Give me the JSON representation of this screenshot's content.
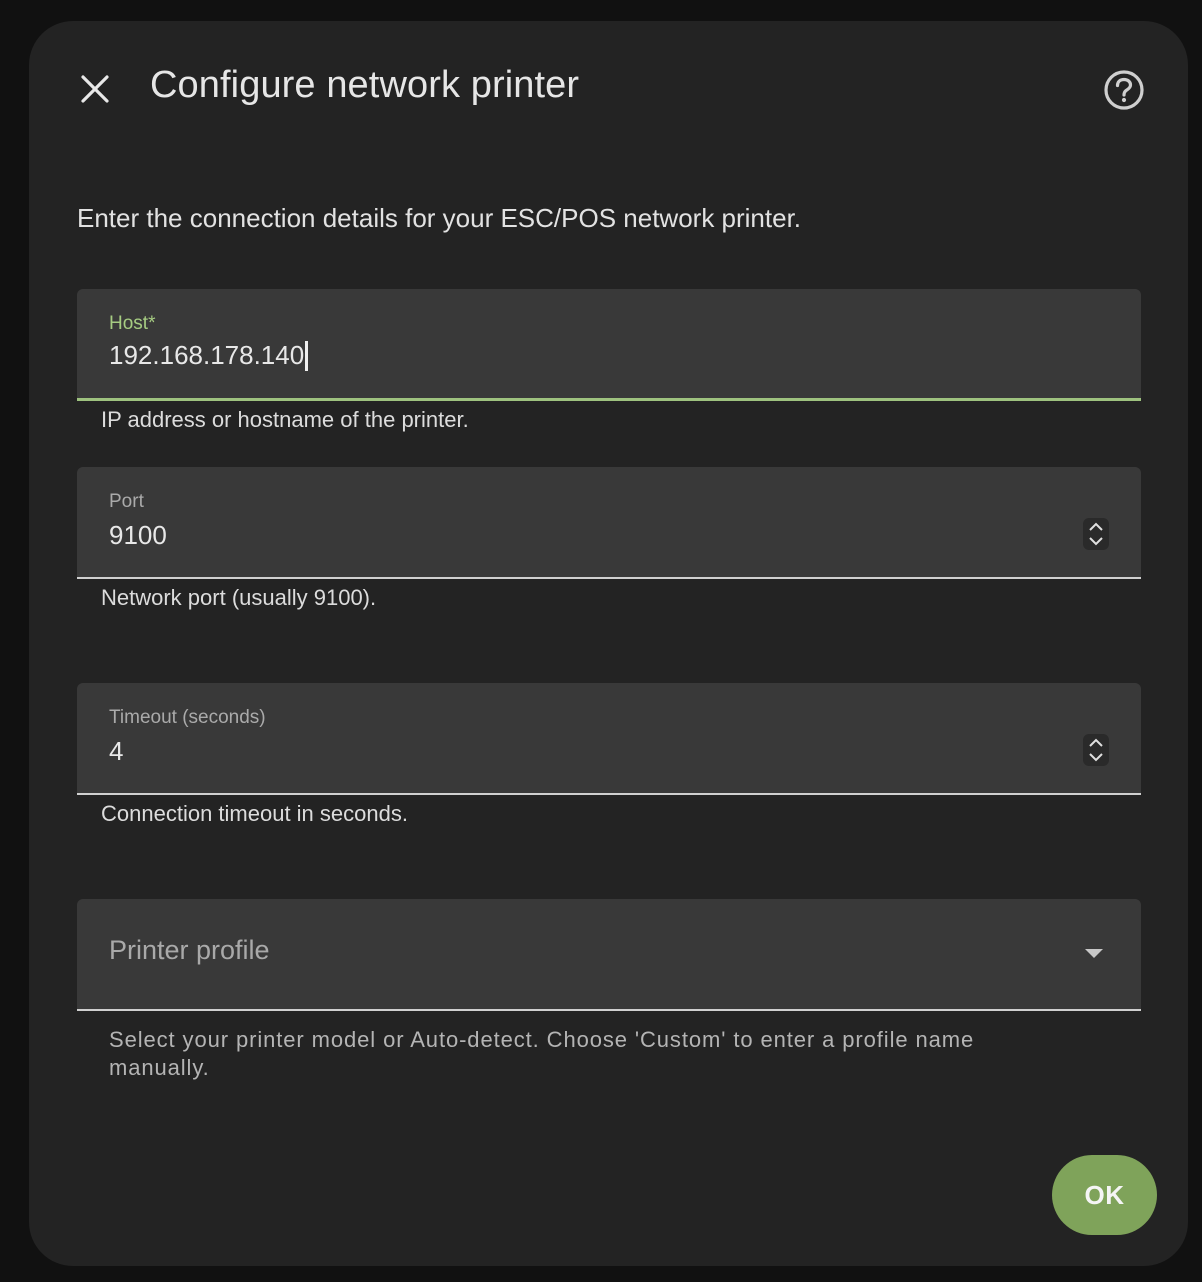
{
  "dialog": {
    "title": "Configure network printer",
    "intro": "Enter the connection details for your ESC/POS network printer.",
    "close_icon": "close-icon",
    "help_icon": "help-circle-icon"
  },
  "fields": {
    "host": {
      "label": "Host*",
      "value": "192.168.178.140",
      "helper": "IP address or hostname of the printer."
    },
    "port": {
      "label": "Port",
      "value": "9100",
      "helper": "Network port (usually 9100)."
    },
    "timeout": {
      "label": "Timeout (seconds)",
      "value": "4",
      "helper": "Connection timeout in seconds."
    },
    "profile": {
      "placeholder": "Printer profile",
      "helper": "Select your printer model or Auto-detect. Choose 'Custom' to enter a profile name manually."
    }
  },
  "actions": {
    "ok_label": "OK"
  },
  "colors": {
    "accent": "#9ec27f",
    "button": "#7fa35a",
    "surface": "#232323",
    "field": "#393939"
  }
}
